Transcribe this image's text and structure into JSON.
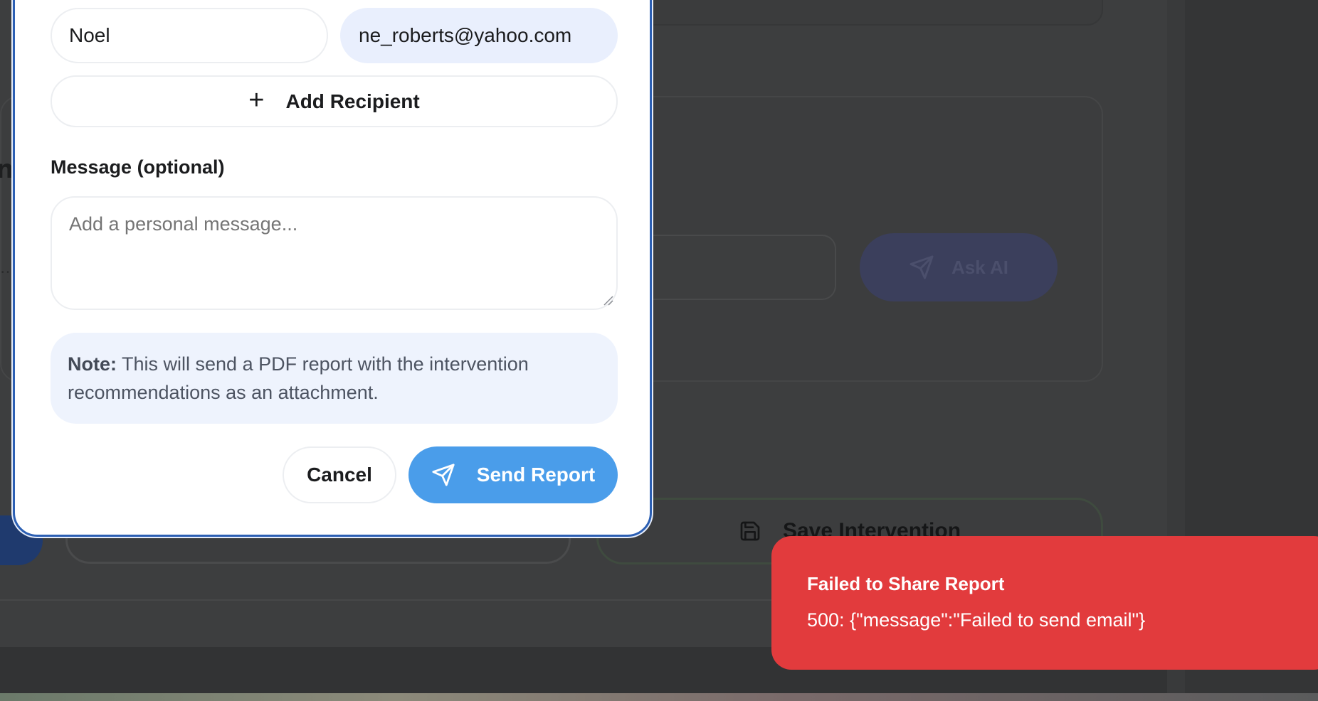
{
  "dialog": {
    "recipient": {
      "name_value": "Noel",
      "email_value": "ne_roberts@yahoo.com"
    },
    "add_recipient_label": "Add Recipient",
    "message_label": "Message (optional)",
    "message_placeholder": "Add a personal message...",
    "note_bold": "Note:",
    "note_text": "This will send a PDF report with the intervention recommendations as an attachment.",
    "cancel_label": "Cancel",
    "send_label": "Send Report"
  },
  "background": {
    "ask_ai_label": "Ask AI",
    "save_intervention_label": "Save Intervention"
  },
  "toast": {
    "title": "Failed to Share Report",
    "message": "500: {\"message\":\"Failed to send email\"}",
    "color": "#e23b3d"
  },
  "colors": {
    "primary": "#4a9dea",
    "modal_border": "#2c5fb3",
    "note_bg": "#eef3fd"
  }
}
